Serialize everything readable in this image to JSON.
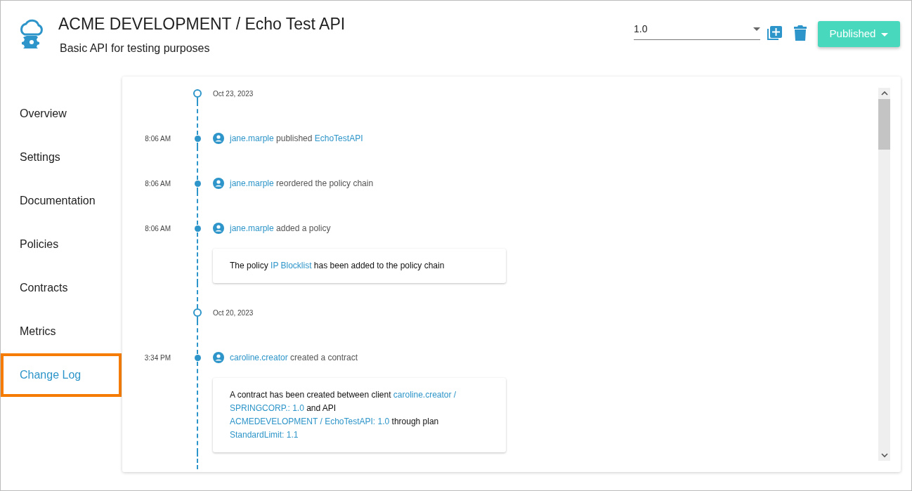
{
  "header": {
    "title": "ACME DEVELOPMENT / Echo Test API",
    "subtitle": "Basic API for testing purposes",
    "version": {
      "value": "1.0"
    },
    "status_button": "Published"
  },
  "sidebar": {
    "items": [
      {
        "label": "Overview",
        "selected": false
      },
      {
        "label": "Settings",
        "selected": false
      },
      {
        "label": "Documentation",
        "selected": false
      },
      {
        "label": "Policies",
        "selected": false
      },
      {
        "label": "Contracts",
        "selected": false
      },
      {
        "label": "Metrics",
        "selected": false
      },
      {
        "label": "Change Log",
        "selected": true
      }
    ]
  },
  "timeline": [
    {
      "kind": "date",
      "label": "Oct 23, 2023"
    },
    {
      "kind": "event",
      "time": "8:06 AM",
      "message": [
        {
          "text": "jane.marple",
          "link": true
        },
        {
          "text": "published",
          "link": false
        },
        {
          "text": "EchoTestAPI",
          "link": true
        }
      ]
    },
    {
      "kind": "event",
      "time": "8:06 AM",
      "message": [
        {
          "text": "jane.marple",
          "link": true
        },
        {
          "text": "reordered the policy chain",
          "link": false
        }
      ]
    },
    {
      "kind": "event",
      "time": "8:06 AM",
      "message": [
        {
          "text": "jane.marple",
          "link": true
        },
        {
          "text": "added a policy",
          "link": false
        }
      ],
      "detail": [
        {
          "text": "The policy",
          "link": false
        },
        {
          "text": "IP Blocklist",
          "link": true
        },
        {
          "text": "has been added to the policy chain",
          "link": false
        }
      ]
    },
    {
      "kind": "date",
      "label": "Oct 20, 2023"
    },
    {
      "kind": "event",
      "time": "3:34 PM",
      "message": [
        {
          "text": "caroline.creator",
          "link": true
        },
        {
          "text": "created a contract",
          "link": false
        }
      ],
      "detail": [
        {
          "text": "A contract has been created between client",
          "link": false
        },
        {
          "text": "caroline.creator /",
          "link": true
        },
        {
          "text": "SPRINGCORP.: 1.0",
          "link": true
        },
        {
          "text": "and API",
          "link": false
        },
        {
          "text": "ACMEDEVELOPMENT / EchoTestAPI: 1.0",
          "link": true
        },
        {
          "text": "through plan",
          "link": false
        },
        {
          "text": "StandardLimit: 1.1",
          "link": true
        }
      ]
    }
  ]
}
